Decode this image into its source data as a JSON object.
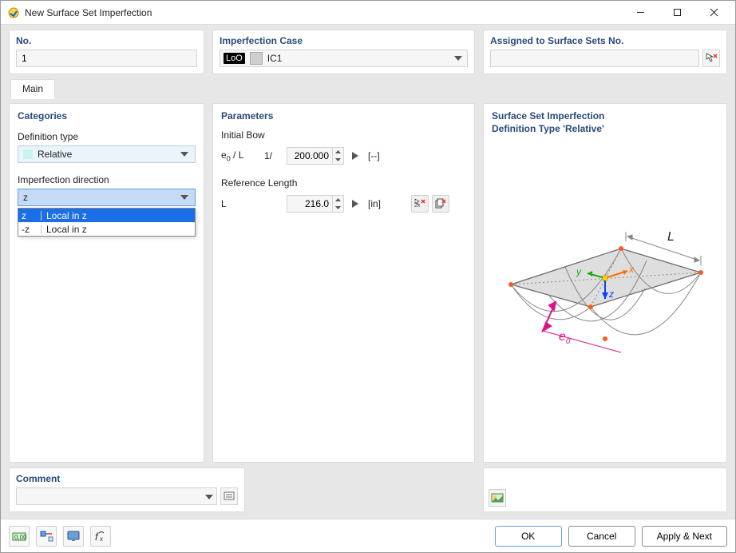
{
  "window": {
    "title": "New Surface Set Imperfection"
  },
  "top": {
    "no_label": "No.",
    "no_value": "1",
    "case_label": "Imperfection Case",
    "case_tag": "LoO",
    "case_value": "IC1",
    "assigned_label": "Assigned to Surface Sets No.",
    "assigned_value": ""
  },
  "tabs": {
    "main": "Main"
  },
  "categories": {
    "title": "Categories",
    "def_type_label": "Definition type",
    "def_type_value": "Relative",
    "dir_label": "Imperfection direction",
    "dir_value": "z",
    "dir_options": [
      {
        "key": "z",
        "desc": "Local in z",
        "selected": true
      },
      {
        "key": "-z",
        "desc": "Local in z",
        "selected": false
      }
    ]
  },
  "parameters": {
    "title": "Parameters",
    "initial_bow_label": "Initial Bow",
    "e0_over_L_label": "e₀ / L",
    "one_over": "1/",
    "e0_over_L_value": "200.000",
    "e0_unit": "[--]",
    "ref_len_label": "Reference Length",
    "L_label": "L",
    "L_value": "216.0",
    "L_unit": "[in]"
  },
  "preview": {
    "line1": "Surface Set Imperfection",
    "line2": "Definition Type 'Relative'",
    "L_label": "L",
    "x_label": "x",
    "y_label": "y",
    "z_label": "z",
    "e0_label": "e₀"
  },
  "comment": {
    "title": "Comment",
    "value": ""
  },
  "buttons": {
    "ok": "OK",
    "cancel": "Cancel",
    "apply_next": "Apply & Next"
  }
}
